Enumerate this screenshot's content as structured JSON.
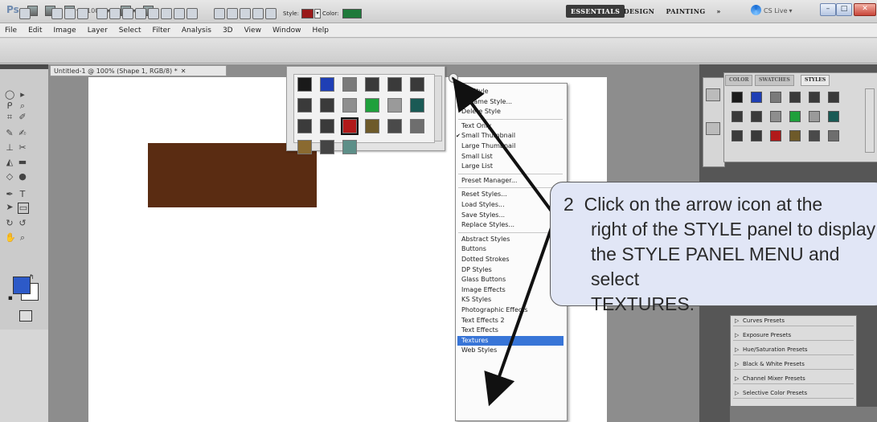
{
  "app": {
    "logo": "Ps",
    "zoom": "100%",
    "workspaces": [
      "ESSENTIALS",
      "DESIGN",
      "PAINTING",
      "»"
    ],
    "cslive": "CS Live"
  },
  "menubar": [
    "File",
    "Edit",
    "Image",
    "Layer",
    "Select",
    "Filter",
    "Analysis",
    "3D",
    "View",
    "Window",
    "Help"
  ],
  "options": {
    "style_label": "Style:",
    "color_label": "Color:",
    "style_color": "#9a1a1a",
    "fill_color": "#1e7a3a"
  },
  "document": {
    "tab_title": "Untitled-1 @ 100% (Shape 1, RGB/8) *",
    "shape_color": "#5a2c12"
  },
  "picker": {
    "swatches": [
      "#1a1a1a",
      "#1f3fb5",
      "#7a7a7a",
      "#3a3a3a",
      "#3a3a3a",
      "#3a3a3a",
      "#3a3a3a",
      "#3a3a3a",
      "#8e8e8e",
      "#1fa03c",
      "#9a9a9a",
      "#1a5a55",
      "#3b3b3b",
      "#3a3a3a",
      "#b11a1a",
      "#6e5a2a",
      "#4a4a4a",
      "#6e6e6e",
      "#8a6a30",
      "#444444",
      "#5d8f88"
    ]
  },
  "style_menu": {
    "items": [
      {
        "label": "No Style",
        "type": "item"
      },
      {
        "label": "Rename Style...",
        "type": "item"
      },
      {
        "label": "Delete Style",
        "type": "item"
      },
      {
        "type": "sep"
      },
      {
        "label": "Text Only",
        "type": "item"
      },
      {
        "label": "Small Thumbnail",
        "type": "item",
        "checked": true
      },
      {
        "label": "Large Thumbnail",
        "type": "item"
      },
      {
        "label": "Small List",
        "type": "item"
      },
      {
        "label": "Large List",
        "type": "item"
      },
      {
        "type": "sep"
      },
      {
        "label": "Preset Manager...",
        "type": "item"
      },
      {
        "type": "sep"
      },
      {
        "label": "Reset Styles...",
        "type": "item"
      },
      {
        "label": "Load Styles...",
        "type": "item"
      },
      {
        "label": "Save Styles...",
        "type": "item"
      },
      {
        "label": "Replace Styles...",
        "type": "item"
      },
      {
        "type": "sep"
      },
      {
        "label": "Abstract Styles",
        "type": "item"
      },
      {
        "label": "Buttons",
        "type": "item"
      },
      {
        "label": "Dotted Strokes",
        "type": "item"
      },
      {
        "label": "DP Styles",
        "type": "item"
      },
      {
        "label": "Glass Buttons",
        "type": "item"
      },
      {
        "label": "Image Effects",
        "type": "item"
      },
      {
        "label": "KS Styles",
        "type": "item"
      },
      {
        "label": "Photographic Effects",
        "type": "item"
      },
      {
        "label": "Text Effects 2",
        "type": "item"
      },
      {
        "label": "Text Effects",
        "type": "item"
      },
      {
        "label": "Textures",
        "type": "item",
        "selected": true
      },
      {
        "label": "Web Styles",
        "type": "item"
      }
    ]
  },
  "right_panel": {
    "tabs": [
      "COLOR",
      "SWATCHES",
      "STYLES"
    ],
    "active_tab": "STYLES",
    "swatches": [
      "#1a1a1a",
      "#1f3fb5",
      "#7a7a7a",
      "#3a3a3a",
      "#3a3a3a",
      "#3a3a3a",
      "#3a3a3a",
      "#3a3a3a",
      "#8e8e8e",
      "#1fa03c",
      "#9a9a9a",
      "#1a5a55",
      "#3b3b3b",
      "#3a3a3a",
      "#b11a1a",
      "#6e5a2a",
      "#4a4a4a",
      "#6e6e6e"
    ],
    "adjustments": [
      "Curves Presets",
      "Exposure Presets",
      "Hue/Saturation Presets",
      "Black & White Presets",
      "Channel Mixer Presets",
      "Selective Color Presets"
    ]
  },
  "callout": {
    "number": "2",
    "lines": [
      "Click on the arrow icon at the",
      "right of the STYLE panel to display",
      "the STYLE PANEL MENU and select",
      "TEXTURES."
    ]
  }
}
